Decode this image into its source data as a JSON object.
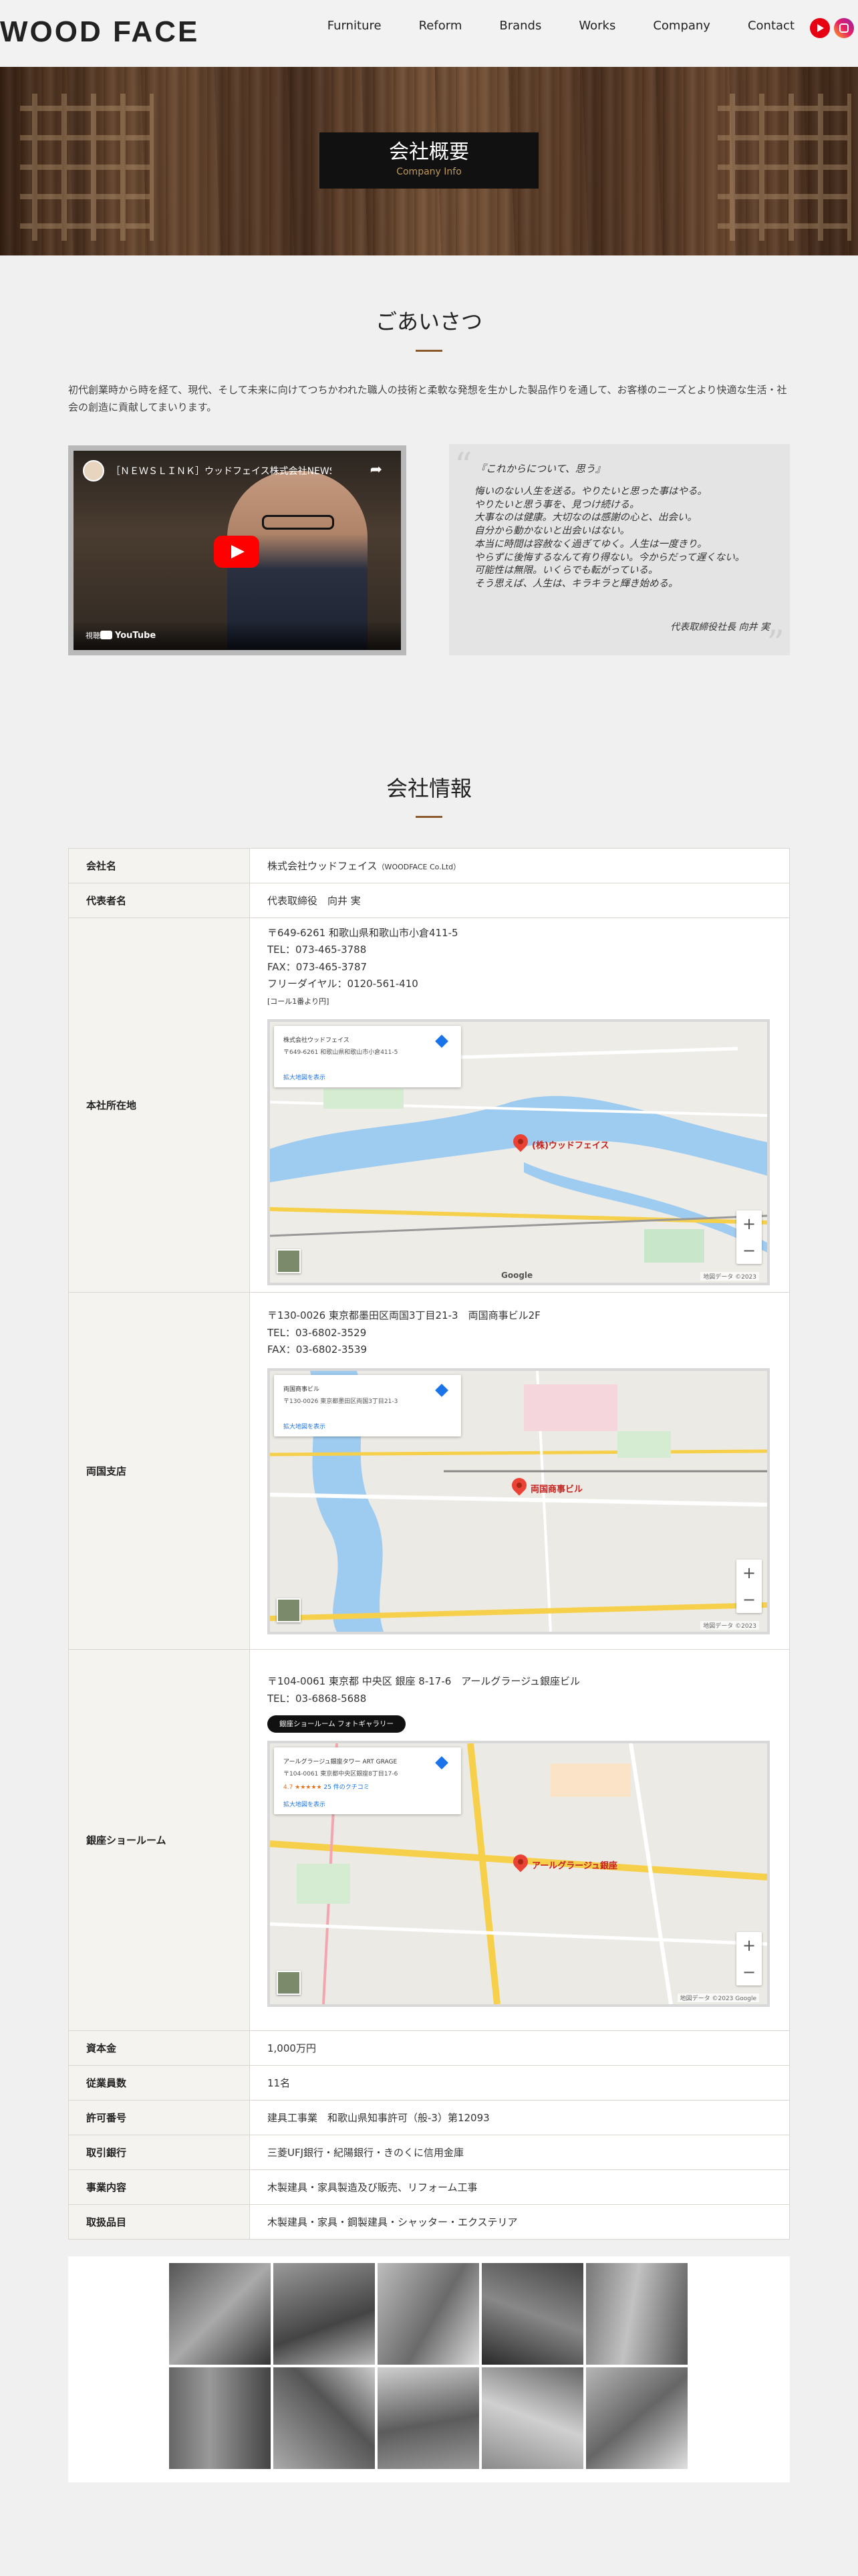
{
  "header": {
    "logo": "WOOD FACE",
    "nav": [
      "Furniture",
      "Reform",
      "Brands",
      "Works",
      "Company",
      "Contact"
    ]
  },
  "hero": {
    "title": "会社概要",
    "subtitle": "Company Info"
  },
  "greeting": {
    "heading": "ごあいさつ",
    "text": "初代創業時から時を経て、現代、そして未来に向けてつちかわれた職人の技術と柔軟な発想を生かした製品作りを通して、お客様のニーズとより快適な生活・社会の創造に貢献してまいります。"
  },
  "video": {
    "title": "［ＮＥＷＳＬＩＮＫ］ウッドフェイス株式会社NEWSリンク",
    "watch_label": "視聴",
    "brand": "YouTube"
  },
  "quote": {
    "title": "『これからについて、思う』",
    "lines": [
      "悔いのない人生を送る。やりたいと思った事はやる。",
      "やりたいと思う事を、見つけ続ける。",
      "大事なのは健康。大切なのは感謝の心と、出会い。",
      "自分から動かないと出会いはない。",
      "本当に時間は容赦なく過ぎてゆく。人生は一度きり。",
      "やらずに後悔するなんて有り得ない。今からだって遅くない。",
      "可能性は無限。いくらでも転がっている。",
      "そう思えば、人生は、キラキラと輝き始める。"
    ],
    "signature": "代表取締役社長 向井 実"
  },
  "company": {
    "heading": "会社情報",
    "rows": {
      "name": {
        "label": "会社名",
        "value": "株式会社ウッドフェイス",
        "note": "（WOODFACE Co.Ltd）"
      },
      "rep": {
        "label": "代表者名",
        "value": "代表取締役　向井 実"
      },
      "hq": {
        "label": "本社所在地",
        "lines": [
          "〒649-6261 和歌山県和歌山市小倉411-5",
          "TEL：073-465-3788",
          "FAX：073-465-3787",
          "フリーダイヤル：0120-561-410"
        ],
        "note": "[コール1番より円]",
        "map": {
          "card_title": "株式会社ウッドフェイス",
          "card_addr": "〒649-6261 和歌山県和歌山市小倉411-5",
          "link": "拡大地図を表示",
          "pin_label": "(株)ウッドフェイス",
          "copyright": "地図データ ©2023"
        }
      },
      "ryogoku": {
        "label": "両国支店",
        "lines": [
          "〒130-0026 東京都墨田区両国3丁目21-3　両国商事ビル2F",
          "TEL：03-6802-3529",
          "FAX：03-6802-3539"
        ],
        "map": {
          "card_title": "両国商事ビル",
          "card_addr": "〒130-0026 東京都墨田区両国3丁目21-3",
          "link": "拡大地図を表示",
          "pin_label": "両国商事ビル",
          "copyright": "地図データ ©2023"
        }
      },
      "ginza": {
        "label": "銀座ショールーム",
        "lines": [
          "〒104-0061 東京都 中央区 銀座 8-17-6　アールグラージュ銀座ビル",
          "TEL：03-6868-5688"
        ],
        "button": "銀座ショールーム フォトギャラリー",
        "map": {
          "card_title": "アールグラージュ銀座タワー ART GRAGE",
          "card_addr": "〒104-0061 東京都中央区銀座8丁目17-6",
          "rating": "4.7 ★★★★★",
          "reviews": "25 件のクチコミ",
          "link": "拡大地図を表示",
          "pin_label": "アールグラージュ銀座",
          "copyright": "地図データ ©2023 Google"
        }
      },
      "capital": {
        "label": "資本金",
        "value": "1,000万円"
      },
      "employees": {
        "label": "従業員数",
        "value": "11名"
      },
      "license": {
        "label": "許可番号",
        "value": "建具工事業　和歌山県知事許可（般-3）第12093"
      },
      "banks": {
        "label": "取引銀行",
        "value": "三菱UFJ銀行・紀陽銀行・きのくに信用金庫"
      },
      "business": {
        "label": "事業内容",
        "value": "木製建具・家具製造及び販売、リフォーム工事"
      },
      "products": {
        "label": "取扱品目",
        "value": "木製建具・家具・鋼製建具・シャッター・エクステリア"
      }
    }
  },
  "map_common": {
    "google": "Google",
    "zoom_in": "+",
    "zoom_out": "−"
  },
  "colors": {
    "accent": "#8b5a2b",
    "header_bg": "#f2f2f2",
    "page_bg": "#f0f0f0",
    "youtube": "#e60012"
  }
}
